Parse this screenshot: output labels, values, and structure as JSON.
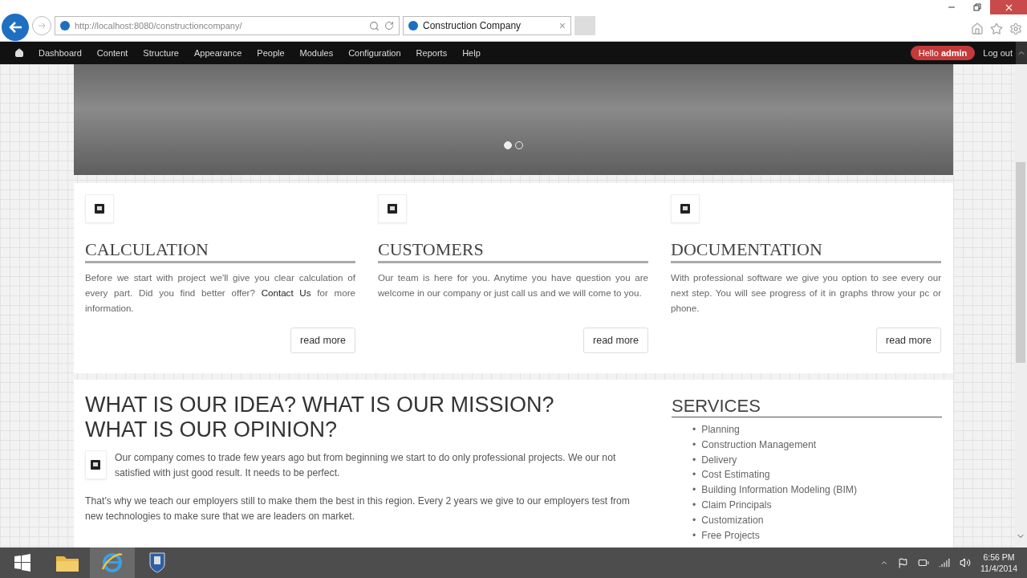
{
  "browser": {
    "address": "http://localhost:8080/constructioncompany/",
    "tab": {
      "title": "Construction Company",
      "close": "×"
    }
  },
  "admin_menu": {
    "items": [
      "Dashboard",
      "Content",
      "Structure",
      "Appearance",
      "People",
      "Modules",
      "Configuration",
      "Reports",
      "Help"
    ],
    "greeting": "Hello **admin**",
    "logout": "Log out"
  },
  "slider": {
    "dots": [
      {
        "selected": true
      },
      {
        "selected": false
      }
    ]
  },
  "features": [
    {
      "title": "CALCULATION",
      "text_before": "Before we start with project we'll give you clear calculation of every part. Did you find better offer?",
      "link": "Contact Us",
      "text_after": "for more information.",
      "button": "read more"
    },
    {
      "title": "CUSTOMERS",
      "text_before": "Our team is here for you. Anytime you have question you are welcome in our company or just call us and we will come to you.",
      "button": "read more"
    },
    {
      "title": "DOCUMENTATION",
      "text_before": "With professional software we give you option to see every our next step. You will see progress of it in graphs throw your pc or phone.",
      "button": "read more"
    }
  ],
  "mission": {
    "title_lines": [
      "WHAT IS OUR IDEA? WHAT IS OUR MISSION?",
      "WHAT IS OUR OPINION?"
    ],
    "intro": "Our company comes to trade few years ago but from beginning we start to do only professional projects. We our not satisfied with just good result. It needs to be perfect.",
    "paragraphs": [
      "That's why we teach our employers still to make them the best in this region. Every 2 years we give to our employers test from new technologies to make sure that we are leaders on market."
    ]
  },
  "services": {
    "title": "SERVICES",
    "items": [
      {
        "marker": "•",
        "label": "Planning"
      },
      {
        "marker": "•",
        "label": "Construction Management"
      },
      {
        "marker": "•",
        "label": "Delivery"
      },
      {
        "marker": "•",
        "label": "Cost Estimating"
      },
      {
        "marker": "•",
        "label": "Building Information Modeling (BIM)"
      },
      {
        "marker": "•",
        "label": "Claim Principals"
      },
      {
        "marker": "•",
        "label": "Customization"
      },
      {
        "marker": "•",
        "label": "Free Projects"
      }
    ]
  },
  "taskbar": {
    "apps": [
      {
        "kind": "folder",
        "selected": false
      },
      {
        "kind": "browser",
        "selected": true
      },
      {
        "kind": "shield",
        "selected": false
      }
    ],
    "time": "6:56 PM",
    "date": "11/4/2014"
  }
}
